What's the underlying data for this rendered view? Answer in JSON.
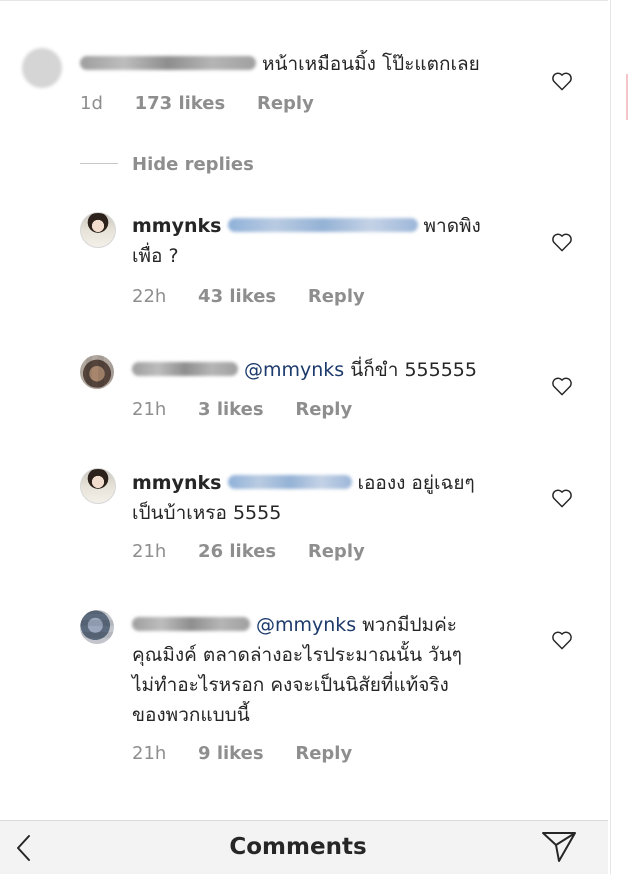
{
  "comments": [
    {
      "username": "",
      "text": "หน้าเหมือนมิ้ง โป๊ะแตกเลย",
      "time": "1d",
      "likes": "173 likes",
      "reply_label": "Reply"
    }
  ],
  "hide_replies_label": "Hide replies",
  "replies": [
    {
      "username": "mmynks",
      "text": "พาดพิง",
      "text_line2": "เพื่อ ?",
      "time": "22h",
      "likes": "43 likes",
      "reply_label": "Reply"
    },
    {
      "mention": "@mmynks",
      "text": "นี่ก็ขำ 555555",
      "time": "21h",
      "likes": "3 likes",
      "reply_label": "Reply"
    },
    {
      "username": "mmynks",
      "text": "เอองง อยู่เฉยๆ",
      "text_line2": "เป็นบ้าเหรอ 5555",
      "time": "21h",
      "likes": "26 likes",
      "reply_label": "Reply"
    },
    {
      "mention": "@mmynks",
      "text": "พวกมีปมค่ะ",
      "text_line2": "คุณมิงค์ ตลาดล่างอะไรประมาณนั้น วันๆ",
      "text_line3": "ไม่ทำอะไรหรอก คงจะเป็นนิสัยที่แท้จริง",
      "text_line4": "ของพวกแบบนี้",
      "time": "21h",
      "likes": "9 likes",
      "reply_label": "Reply"
    }
  ],
  "bottom_bar": {
    "title": "Comments",
    "back_icon": "chevron-left-icon",
    "send_icon": "send-icon"
  },
  "colors": {
    "text": "#262626",
    "meta": "#8e8e8e",
    "mention": "#1c3a6b",
    "bar_bg": "#f3f3f3"
  }
}
